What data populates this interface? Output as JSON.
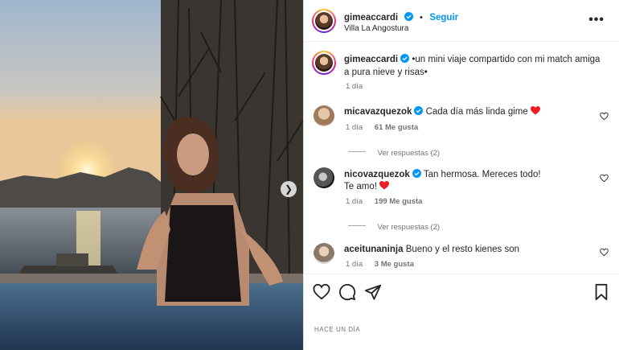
{
  "header": {
    "username": "gimeaccardi",
    "follow_label": "Seguir",
    "separator": "•",
    "location": "Villa La Angostura"
  },
  "caption": {
    "username": "gimeaccardi",
    "text": "•un mini viaje compartido con mi match amiga a pura nieve y risas•",
    "time": "1 día"
  },
  "comments": [
    {
      "username": "micavazquezok",
      "verified": true,
      "text": "Cada día más linda gime",
      "emoji": "red-heart",
      "time": "1 día",
      "likes": "61 Me gusta",
      "replies": "Ver respuestas (2)"
    },
    {
      "username": "nicovazquezok",
      "verified": true,
      "text": "Tan hermosa. Mereces todo!",
      "text2": "Te amo!",
      "emoji": "red-heart",
      "time": "1 día",
      "likes": "199 Me gusta",
      "replies": "Ver respuestas (2)"
    },
    {
      "username": "aceitunaninja",
      "verified": false,
      "text": "Bueno y el resto kienes son",
      "time": "1 día",
      "likes": "3 Me gusta"
    }
  ],
  "footer": {
    "timestamp": "HACE UN DÍA"
  },
  "colors": {
    "accent": "#0095f6",
    "verified": "#0095f6",
    "heart": "#ed1d24",
    "muted": "#737373"
  },
  "icons": {
    "like": "heart-outline-icon",
    "comment": "comment-icon",
    "share": "send-icon",
    "save": "bookmark-icon",
    "more": "more-options-icon",
    "next": "chevron-right-icon"
  }
}
